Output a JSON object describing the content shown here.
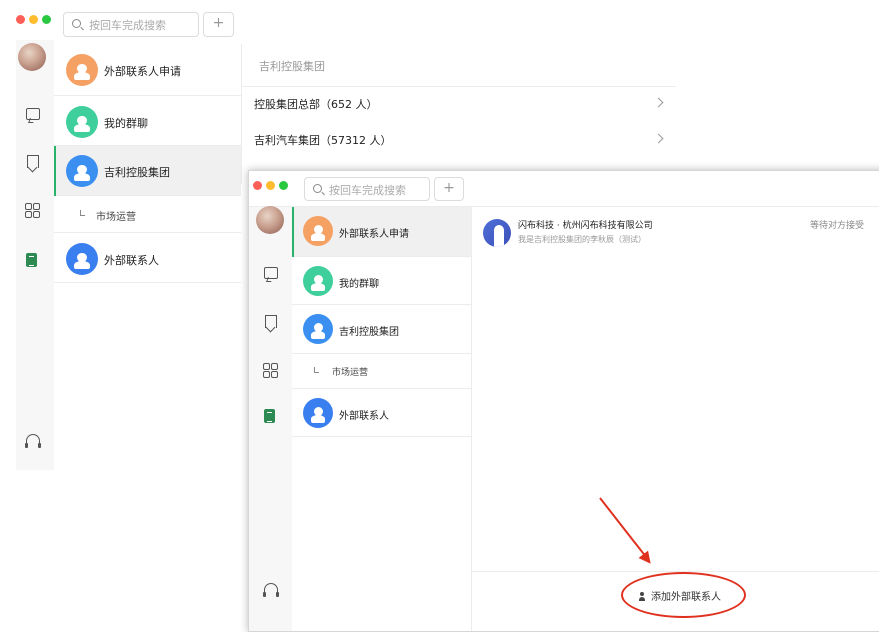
{
  "search": {
    "placeholder": "按回车完成搜索"
  },
  "plus_label": "+",
  "contact_items": [
    {
      "label": "外部联系人申请",
      "color": "#f5a164"
    },
    {
      "label": "我的群聊",
      "color": "#3fcf9c"
    },
    {
      "label": "吉利控股集团",
      "color": "#3a8ff0"
    },
    {
      "label": "市场运营"
    },
    {
      "label": "外部联系人",
      "color": "#3a7ff0"
    }
  ],
  "org": {
    "title": "吉利控股集团",
    "rows": [
      {
        "label": "控股集团总部（652 人）"
      },
      {
        "label": "吉利汽车集团（57312 人）"
      }
    ]
  },
  "request": {
    "name": "闪布科技 · 杭州闪布科技有限公司",
    "message": "我是吉利控股集团的李秋辰（测试）",
    "status": "等待对方接受"
  },
  "add_button": {
    "label": "添加外部联系人"
  },
  "colors": {
    "accent": "#29b26a",
    "annotation": "#e0301e"
  }
}
